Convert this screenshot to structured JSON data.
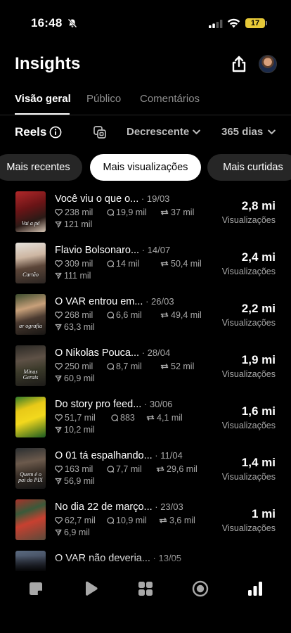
{
  "status_bar": {
    "time": "16:48",
    "battery": "17"
  },
  "header": {
    "title": "Insights"
  },
  "tabs": [
    {
      "label": "Visão geral",
      "active": true
    },
    {
      "label": "Público",
      "active": false
    },
    {
      "label": "Comentários",
      "active": false
    }
  ],
  "filters": {
    "content_type": "Reels",
    "sort": "Decrescente",
    "period": "365 dias"
  },
  "chips": [
    {
      "label": "Mais recentes",
      "selected": false
    },
    {
      "label": "Mais visualizações",
      "selected": true
    },
    {
      "label": "Mais curtidas",
      "selected": false
    }
  ],
  "reels": [
    {
      "title": "Você viu o que o...",
      "date": "19/03",
      "likes": "238 mil",
      "comments": "19,9 mil",
      "reposts": "37 mil",
      "shares": "121 mil",
      "value": "2,8 mi",
      "metric": "Visualizações",
      "thumb_caption": "Vai a pé"
    },
    {
      "title": "Flavio Bolsonaro...",
      "date": "14/07",
      "likes": "309 mil",
      "comments": "14 mil",
      "reposts": "50,4 mil",
      "shares": "111 mil",
      "value": "2,4 mi",
      "metric": "Visualizações",
      "thumb_caption": "Cartão"
    },
    {
      "title": "O VAR entrou em...",
      "date": "26/03",
      "likes": "268 mil",
      "comments": "6,6 mil",
      "reposts": "49,4 mil",
      "shares": "63,3 mil",
      "value": "2,2 mi",
      "metric": "Visualizações",
      "thumb_caption": "ar ografia"
    },
    {
      "title": "O Nikolas Pouca...",
      "date": "28/04",
      "likes": "250 mil",
      "comments": "8,7 mil",
      "reposts": "52 mil",
      "shares": "60,9 mil",
      "value": "1,9 mi",
      "metric": "Visualizações",
      "thumb_caption": "Minas Gerais"
    },
    {
      "title": "Do story pro feed...",
      "date": "30/06",
      "likes": "51,7 mil",
      "comments": "883",
      "reposts": "4,1 mil",
      "shares": "10,2 mil",
      "value": "1,6 mi",
      "metric": "Visualizações",
      "thumb_caption": ""
    },
    {
      "title": "O 01 tá espalhando...",
      "date": "11/04",
      "likes": "163 mil",
      "comments": "7,7 mil",
      "reposts": "29,6 mil",
      "shares": "56,9 mil",
      "value": "1,4 mi",
      "metric": "Visualizações",
      "thumb_caption": "Quem é o pai do PIX"
    },
    {
      "title": "No dia 22 de março...",
      "date": "23/03",
      "likes": "62,7 mil",
      "comments": "10,9 mil",
      "reposts": "3,6 mil",
      "shares": "6,9 mil",
      "value": "1 mi",
      "metric": "Visualizações",
      "thumb_caption": ""
    },
    {
      "title": "O VAR não deveria...",
      "date": "13/05",
      "likes": "",
      "comments": "",
      "reposts": "",
      "shares": "",
      "value": "",
      "metric": "",
      "thumb_caption": ""
    }
  ],
  "colors": {
    "background": "#000000",
    "muted": "#a8a8a8",
    "chip_bg": "#262626",
    "battery": "#e6c838"
  },
  "icons": [
    "bell-off-icon",
    "signal-icon",
    "wifi-icon",
    "share-upload-icon",
    "info-icon",
    "copy-icon",
    "chevron-down-icon",
    "heart-icon",
    "comment-icon",
    "repost-icon",
    "send-icon",
    "nav-posts-icon",
    "nav-reels-icon",
    "nav-grid-icon",
    "nav-live-icon",
    "nav-insights-icon"
  ]
}
